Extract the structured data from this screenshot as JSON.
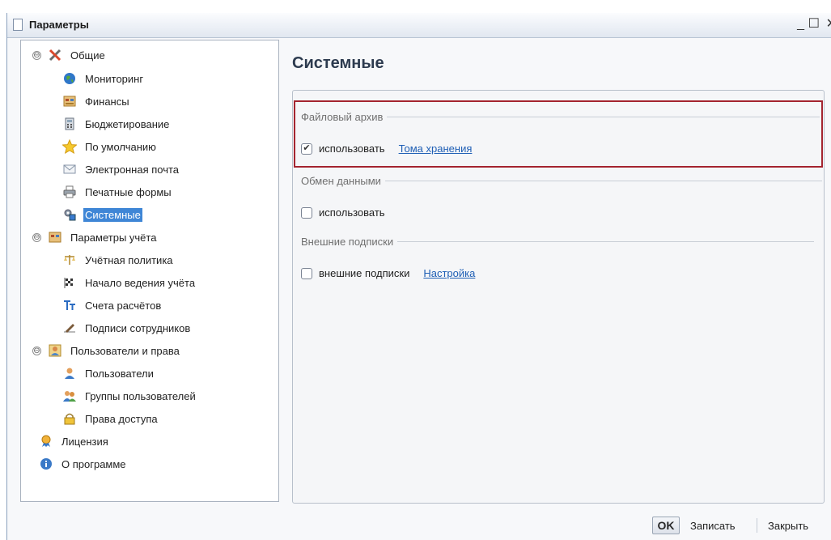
{
  "window": {
    "title": "Параметры",
    "minimize_glyph": "_",
    "maximize_glyph": "☐",
    "close_glyph": "✕"
  },
  "tree": {
    "items": [
      {
        "label": "Общие",
        "icon": "tools-icon",
        "toggle": "⊖"
      },
      {
        "label": "Мониторинг",
        "icon": "globe-icon"
      },
      {
        "label": "Финансы",
        "icon": "finance-icon"
      },
      {
        "label": "Бюджетирование",
        "icon": "calculator-icon"
      },
      {
        "label": "По умолчанию",
        "icon": "star-icon"
      },
      {
        "label": "Электронная почта",
        "icon": "mail-icon"
      },
      {
        "label": "Печатные формы",
        "icon": "printer-icon"
      },
      {
        "label": "Системные",
        "icon": "system-icon",
        "selected": true
      },
      {
        "label": "Параметры учёта",
        "icon": "ledger-icon",
        "toggle": "⊖"
      },
      {
        "label": "Учётная политика",
        "icon": "scales-icon"
      },
      {
        "label": "Начало ведения учёта",
        "icon": "flag-icon"
      },
      {
        "label": "Счета расчётов",
        "icon": "accounts-icon"
      },
      {
        "label": "Подписи сотрудников",
        "icon": "signature-icon"
      },
      {
        "label": "Пользователи и права",
        "icon": "users-rights-icon",
        "toggle": "⊖"
      },
      {
        "label": "Пользователи",
        "icon": "user-icon"
      },
      {
        "label": "Группы пользователей",
        "icon": "user-group-icon"
      },
      {
        "label": "Права доступа",
        "icon": "lock-icon"
      },
      {
        "label": "Лицензия",
        "icon": "license-icon"
      },
      {
        "label": "О программе",
        "icon": "info-icon"
      }
    ]
  },
  "panel": {
    "title": "Системные",
    "groups": {
      "file_archive": {
        "title": "Файловый архив",
        "checkbox_label": "использовать",
        "checked": true,
        "link": "Тома хранения"
      },
      "data_exchange": {
        "title": "Обмен данными",
        "checkbox_label": "использовать",
        "checked": false
      },
      "external_signatures": {
        "title": "Внешние подписки",
        "checkbox_label": "внешние подписки",
        "checked": false,
        "link": "Настройка"
      }
    }
  },
  "footer": {
    "ok_label": "OK",
    "save_label": "Записать",
    "close_label": "Закрыть"
  },
  "colors": {
    "selection": "#3f86d6",
    "link": "#1f5fb5",
    "highlight_border": "#a4242f"
  }
}
